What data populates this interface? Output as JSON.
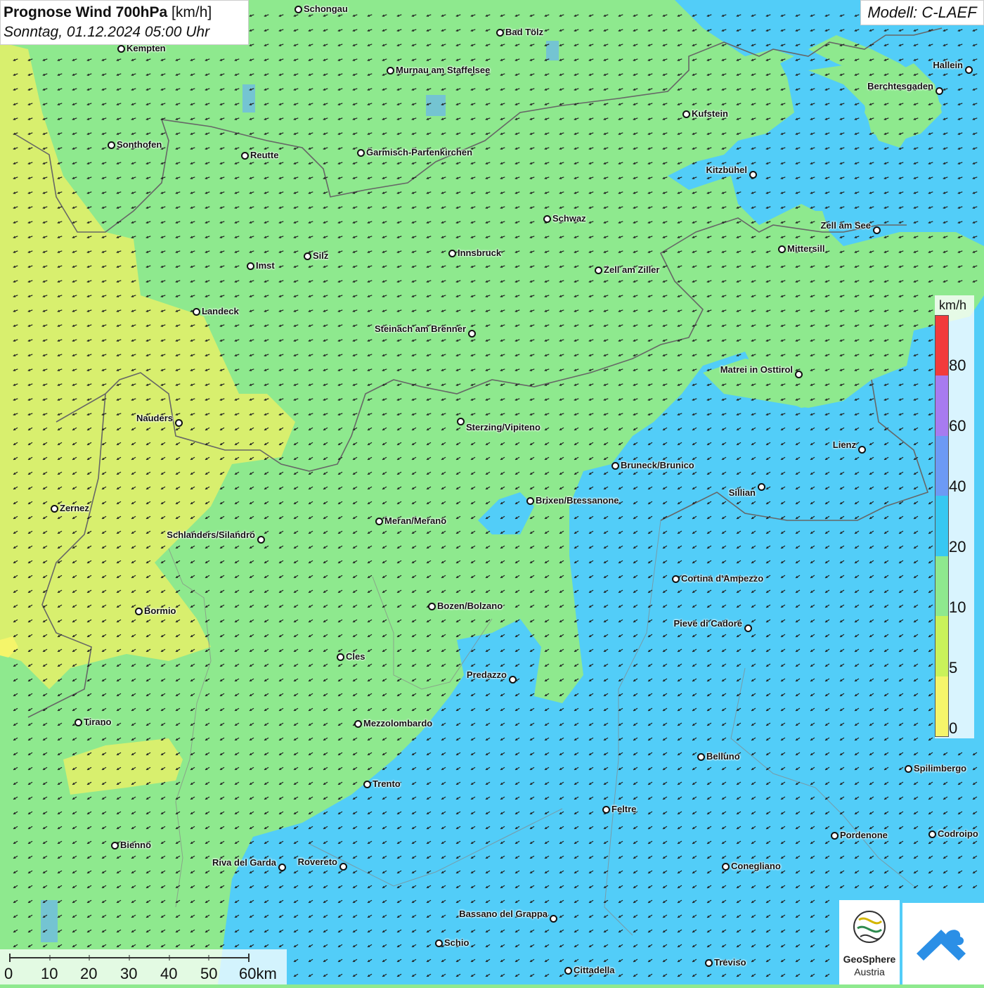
{
  "title": {
    "main": "Prognose Wind 700hPa",
    "unit": "[km/h]",
    "datetime": "Sonntag, 01.12.2024 05:00 Uhr"
  },
  "model": "Modell: C-LAEF",
  "legend": {
    "unit": "km/h",
    "labels": [
      "80",
      "60",
      "40",
      "20",
      "10",
      "5",
      "0"
    ],
    "colors": [
      "#f23b3b",
      "#a77bf0",
      "#6c9af5",
      "#37c8f2",
      "#8ee98e",
      "#c9f25a",
      "#f5f56a"
    ]
  },
  "scale": {
    "labels": [
      "0",
      "10",
      "20",
      "30",
      "40",
      "50",
      "60km"
    ]
  },
  "logo": {
    "name": "GeoSphere",
    "sub": "Austria"
  },
  "colors": {
    "calm_yellow": "#d8ef6e",
    "green": "#8ee98e",
    "blue": "#52cdf8",
    "blue_dark": "#3dbff5"
  },
  "cities": [
    {
      "name": "Schongau"
    },
    {
      "name": "Bad Tölz"
    },
    {
      "name": "Kempten"
    },
    {
      "name": "Murnau am Staffelsee"
    },
    {
      "name": "Hallein"
    },
    {
      "name": "Berchtesgaden"
    },
    {
      "name": "Kufstein"
    },
    {
      "name": "Sonthofen"
    },
    {
      "name": "Reutte"
    },
    {
      "name": "Garmisch-Partenkirchen"
    },
    {
      "name": "Kitzbühel"
    },
    {
      "name": "Schwaz"
    },
    {
      "name": "Zell am See"
    },
    {
      "name": "Mittersill"
    },
    {
      "name": "Silz"
    },
    {
      "name": "Innsbruck"
    },
    {
      "name": "Imst"
    },
    {
      "name": "Zell am Ziller"
    },
    {
      "name": "Landeck"
    },
    {
      "name": "Steinach am Brenner"
    },
    {
      "name": "Matrei in Osttirol"
    },
    {
      "name": "Nauders"
    },
    {
      "name": "Sterzing/Vipiteno"
    },
    {
      "name": "Lienz"
    },
    {
      "name": "Bruneck/Brunico"
    },
    {
      "name": "Sillian"
    },
    {
      "name": "Zernez"
    },
    {
      "name": "Brixen/Bressanone"
    },
    {
      "name": "Meran/Merano"
    },
    {
      "name": "Schlanders/Silandro"
    },
    {
      "name": "Cortina d'Ampezzo"
    },
    {
      "name": "Bozen/Bolzano"
    },
    {
      "name": "Bormio"
    },
    {
      "name": "Pieve di Cadore"
    },
    {
      "name": "Cles"
    },
    {
      "name": "Predazzo"
    },
    {
      "name": "Tirano"
    },
    {
      "name": "Mezzolombardo"
    },
    {
      "name": "Belluno"
    },
    {
      "name": "Spilimbergo"
    },
    {
      "name": "Trento"
    },
    {
      "name": "Feltre"
    },
    {
      "name": "Pordenone"
    },
    {
      "name": "Codroipo"
    },
    {
      "name": "Bienno"
    },
    {
      "name": "Riva del Garda"
    },
    {
      "name": "Rovereto"
    },
    {
      "name": "Conegliano"
    },
    {
      "name": "Bassano del Grappa"
    },
    {
      "name": "Schio"
    },
    {
      "name": "Treviso"
    },
    {
      "name": "Cittadella"
    }
  ]
}
